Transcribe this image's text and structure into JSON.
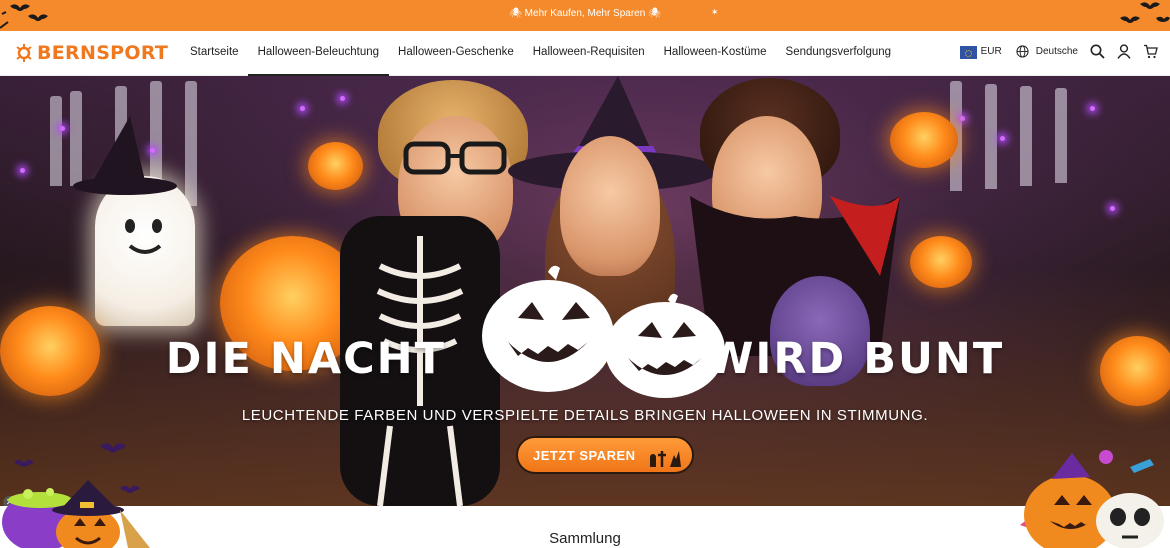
{
  "announcement": {
    "text": "🕷 Mehr Kaufen, Mehr Sparen 🕷",
    "star": "✶"
  },
  "brand": {
    "name": "BERNSPORT",
    "color": "#f0781e"
  },
  "nav": {
    "items": [
      {
        "label": "Startseite"
      },
      {
        "label": "Halloween-Beleuchtung"
      },
      {
        "label": "Halloween-Geschenke"
      },
      {
        "label": "Halloween-Requisiten"
      },
      {
        "label": "Halloween-Kostüme"
      },
      {
        "label": "Sendungsverfolgung"
      }
    ]
  },
  "header_right": {
    "currency": "EUR",
    "language": "Deutsche"
  },
  "hero": {
    "title_left": "DIE NACHT",
    "title_right": "WIRD BUNT",
    "subtitle": "LEUCHTENDE FARBEN UND VERSPIELTE DETAILS BRINGEN HALLOWEEN IN STIMMUNG.",
    "cta": "JETZT SPAREN",
    "close": "✕"
  },
  "section": {
    "title": "Sammlung"
  },
  "colors": {
    "accent": "#f58a2c",
    "text": "#222222"
  },
  "icons": [
    "bat-icon",
    "logo-sun-icon",
    "eu-flag-icon",
    "globe-icon",
    "search-icon",
    "account-icon",
    "cart-icon",
    "close-icon"
  ]
}
